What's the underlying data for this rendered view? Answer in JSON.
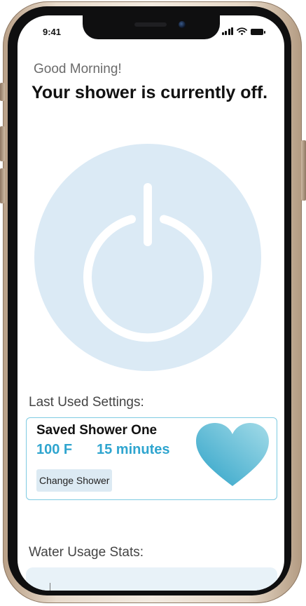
{
  "status_bar": {
    "time": "9:41",
    "icons": [
      "signal-icon",
      "wifi-icon",
      "battery-icon"
    ]
  },
  "greeting": "Good Morning!",
  "headline": "Your shower is currently off.",
  "power_button": {
    "icon": "power-icon",
    "color": "#dbeaf5"
  },
  "last_used": {
    "label": "Last Used Settings:",
    "card": {
      "name": "Saved Shower One",
      "temperature": "100 F",
      "duration": "15 minutes",
      "change_label": "Change Shower",
      "favorite_icon": "heart-icon"
    }
  },
  "water_usage": {
    "label": "Water Usage Stats:"
  },
  "colors": {
    "accent": "#2fa5cf",
    "card_border": "#7fcbe2",
    "power_circle": "#dbeaf5"
  }
}
